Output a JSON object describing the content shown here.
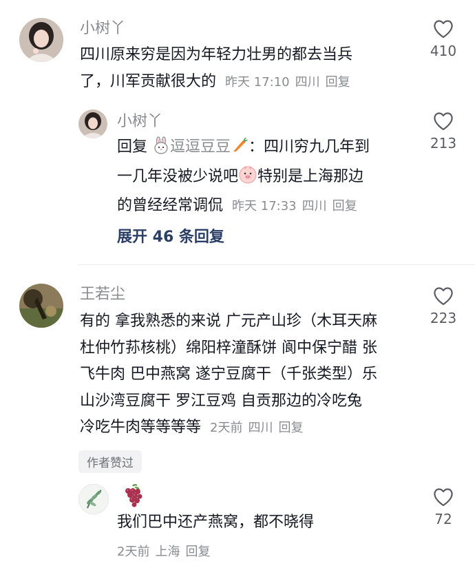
{
  "comments": [
    {
      "username": "小树丫",
      "lines": [
        "四川原来穷是因为年轻力壮男的都去当兵",
        "了，川军贡献很大的"
      ],
      "time": "昨天 17:10",
      "location": "四川",
      "reply_label": "回复",
      "likes": "410",
      "replies": [
        {
          "username": "小树丫",
          "reply_prefix": "回复",
          "reply_to": "逗逗豆豆",
          "line1_after": "：四川穷九几年到",
          "line2_before": "一几年没被少说吧",
          "line2_after": "特别是上海那边",
          "line3": "的曾经经常调侃",
          "time": "昨天 17:33",
          "location": "四川",
          "reply_label": "回复",
          "likes": "213"
        }
      ],
      "expand_label": "展开 46 条回复"
    },
    {
      "username": "王若尘",
      "lines": [
        "有的 拿我熟悉的来说 广元产山珍（木耳天麻",
        "杜仲竹荪核桃）绵阳梓潼酥饼 阆中保宁醋 张",
        "飞牛肉 巴中燕窝 遂宁豆腐干（千张类型）乐",
        "山沙湾豆腐干 罗江豆鸡 自贡那边的冷吃兔",
        "冷吃牛肉等等等等"
      ],
      "time": "2天前",
      "location": "四川",
      "reply_label": "回复",
      "likes": "223",
      "badge": "作者赞过",
      "replies": [
        {
          "username_icon": "grape-icon",
          "text": "我们巴中还产燕窝，都不晓得",
          "time": "2天前",
          "location": "上海",
          "reply_label": "回复",
          "likes": "72"
        }
      ]
    }
  ],
  "colors": {
    "text": "#161823",
    "muted": "#8a8b91",
    "link": "#2b3f66",
    "divider": "#ececee"
  }
}
